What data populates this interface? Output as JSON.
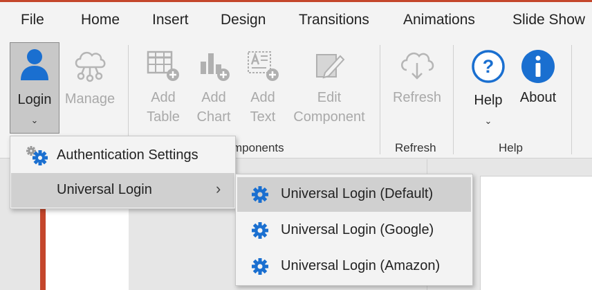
{
  "tabs": [
    "File",
    "Home",
    "Insert",
    "Design",
    "Transitions",
    "Animations",
    "Slide Show"
  ],
  "ribbon": {
    "login": {
      "line1": "Login",
      "chevron": "⌄",
      "icon": "user-icon"
    },
    "manage": {
      "line1": "Manage",
      "icon": "cloud-network-icon"
    },
    "add_table": {
      "line1": "Add",
      "line2": "Table",
      "icon": "table-add-icon"
    },
    "add_chart": {
      "line1": "Add",
      "line2": "Chart",
      "icon": "chart-add-icon"
    },
    "add_text": {
      "line1": "Add",
      "line2": "Text",
      "icon": "text-add-icon"
    },
    "edit_component": {
      "line1": "Edit",
      "line2": "Component",
      "icon": "edit-icon"
    },
    "refresh": {
      "line1": "Refresh",
      "icon": "cloud-download-icon"
    },
    "help": {
      "line1": "Help",
      "chevron": "⌄",
      "icon": "question-circle-icon"
    },
    "about": {
      "line1": "About",
      "icon": "info-circle-icon"
    },
    "groups": {
      "components": "mponents",
      "refresh": "Refresh",
      "help": "Help"
    }
  },
  "login_menu": {
    "items": [
      {
        "label": "Authentication Settings",
        "icon": "gears-icon"
      },
      {
        "label": "Universal Login",
        "arrow": "›"
      }
    ]
  },
  "universal_login_menu": {
    "items": [
      {
        "label": "Universal Login (Default)",
        "icon": "gear-icon"
      },
      {
        "label": "Universal Login (Google)",
        "icon": "gear-icon"
      },
      {
        "label": "Universal Login (Amazon)",
        "icon": "gear-icon"
      }
    ]
  },
  "colors": {
    "accent": "#c4462b",
    "icon_blue": "#1a6fd0",
    "disabled": "#a9a9a9"
  }
}
